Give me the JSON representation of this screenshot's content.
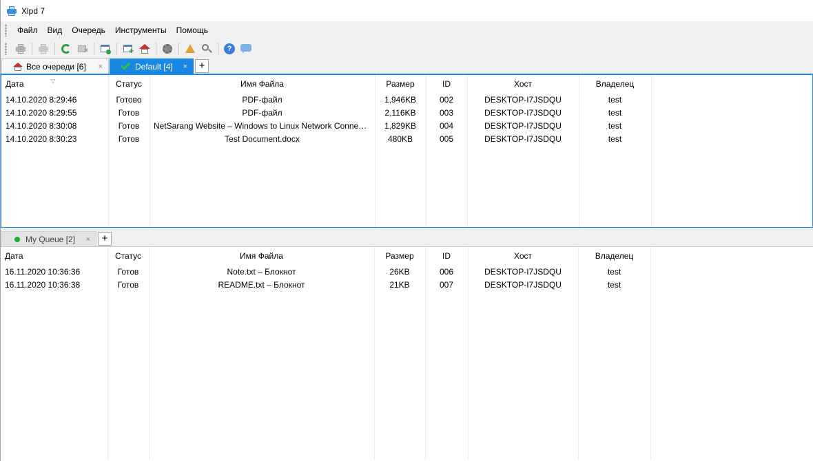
{
  "window": {
    "title": "Xlpd 7"
  },
  "menu": [
    "Файл",
    "Вид",
    "Очередь",
    "Инструменты",
    "Помощь"
  ],
  "toolbar": {
    "icons": [
      "print-icon",
      "print-disabled-icon",
      "refresh-icon",
      "cancel-job-icon",
      "window-settings-icon",
      "add-queue-icon",
      "home-icon",
      "gear-icon",
      "warning-icon",
      "search-icon",
      "help-icon",
      "chat-icon"
    ]
  },
  "top_tabs": [
    {
      "label": "Все очереди [6]",
      "icon": "home-icon",
      "active": false
    },
    {
      "label": "Default [4]",
      "icon": "check-icon",
      "active": true
    }
  ],
  "columns": [
    "Дата",
    "Статус",
    "Имя Файла",
    "Размер",
    "ID",
    "Хост",
    "Владелец"
  ],
  "top_rows": [
    {
      "date": "14.10.2020 8:29:46",
      "status": "Готово",
      "file": "PDF-файл",
      "size": "1,946KB",
      "id": "002",
      "host": "DESKTOP-I7JSDQU",
      "owner": "test"
    },
    {
      "date": "14.10.2020 8:29:55",
      "status": "Готов",
      "file": "PDF-файл",
      "size": "2,116KB",
      "id": "003",
      "host": "DESKTOP-I7JSDQU",
      "owner": "test"
    },
    {
      "date": "14.10.2020 8:30:08",
      "status": "Готов",
      "file": "NetSarang Website – Windows to Linux Network Connect...",
      "size": "1,829KB",
      "id": "004",
      "host": "DESKTOP-I7JSDQU",
      "owner": "test"
    },
    {
      "date": "14.10.2020 8:30:23",
      "status": "Готов",
      "file": "Test Document.docx",
      "size": "480KB",
      "id": "005",
      "host": "DESKTOP-I7JSDQU",
      "owner": "test"
    }
  ],
  "bottom_tabs": [
    {
      "label": "My Queue [2]",
      "icon": "online-dot-icon",
      "active": false
    }
  ],
  "bottom_rows": [
    {
      "date": "16.11.2020 10:36:36",
      "status": "Готов",
      "file": "Note.txt – Блокнот",
      "size": "26KB",
      "id": "006",
      "host": "DESKTOP-I7JSDQU",
      "owner": "test"
    },
    {
      "date": "16.11.2020 10:36:38",
      "status": "Готов",
      "file": "README.txt – Блокнот",
      "size": "21KB",
      "id": "007",
      "host": "DESKTOP-I7JSDQU",
      "owner": "test"
    }
  ],
  "tab_add_label": "+",
  "tab_close_label": "×",
  "colors": {
    "accent": "#1a88e2",
    "online": "#19b23a",
    "check": "#2ec14a"
  }
}
